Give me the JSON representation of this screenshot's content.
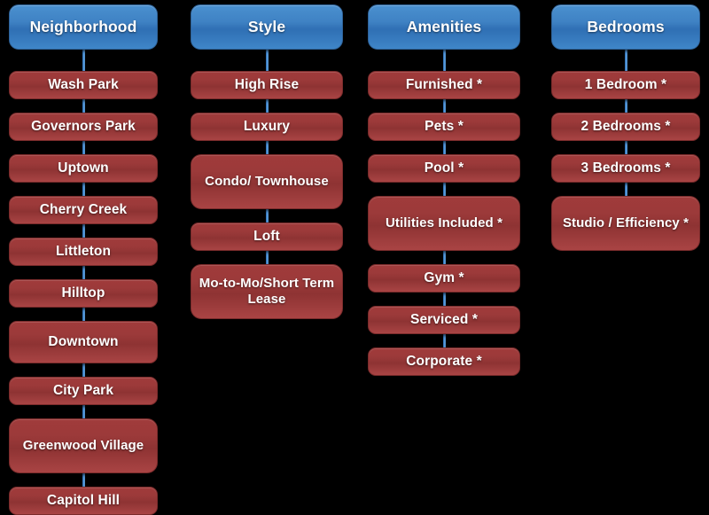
{
  "diagram": {
    "title": "Apartment Search Category Tree",
    "background_color": "#000000",
    "header_color": "#3f82c4",
    "item_color": "#9c3a3a",
    "connector_color": "#4a90d9",
    "columns": [
      {
        "id": "neighborhood",
        "header": "Neighborhood",
        "items": [
          {
            "label": "Wash Park",
            "lines": 1
          },
          {
            "label": "Governors Park",
            "lines": 1
          },
          {
            "label": "Uptown",
            "lines": 1
          },
          {
            "label": "Cherry Creek",
            "lines": 1
          },
          {
            "label": "Littleton",
            "lines": 1
          },
          {
            "label": "Hilltop",
            "lines": 1
          },
          {
            "label": "Downtown",
            "lines": 1
          },
          {
            "label": "City Park",
            "lines": 1
          },
          {
            "label": "Greenwood Village",
            "lines": 2
          },
          {
            "label": "Capitol Hill",
            "lines": 1
          }
        ]
      },
      {
        "id": "style",
        "header": "Style",
        "items": [
          {
            "label": "High Rise",
            "lines": 1
          },
          {
            "label": "Luxury",
            "lines": 1
          },
          {
            "label": "Condo/ Townhouse",
            "lines": 2
          },
          {
            "label": "Loft",
            "lines": 1
          },
          {
            "label": "Mo-to-Mo/Short Term Lease",
            "lines": 2
          }
        ]
      },
      {
        "id": "amenities",
        "header": "Amenities",
        "items": [
          {
            "label": "Furnished *",
            "lines": 1
          },
          {
            "label": "Pets *",
            "lines": 1
          },
          {
            "label": "Pool *",
            "lines": 1
          },
          {
            "label": "Utilities Included *",
            "lines": 2
          },
          {
            "label": "Gym *",
            "lines": 1
          },
          {
            "label": "Serviced *",
            "lines": 1
          },
          {
            "label": "Corporate *",
            "lines": 1
          }
        ]
      },
      {
        "id": "bedrooms",
        "header": "Bedrooms",
        "items": [
          {
            "label": "1 Bedroom *",
            "lines": 1
          },
          {
            "label": "2 Bedrooms *",
            "lines": 1
          },
          {
            "label": "3 Bedrooms *",
            "lines": 1
          },
          {
            "label": "Studio / Efficiency *",
            "lines": 2
          }
        ]
      }
    ]
  }
}
